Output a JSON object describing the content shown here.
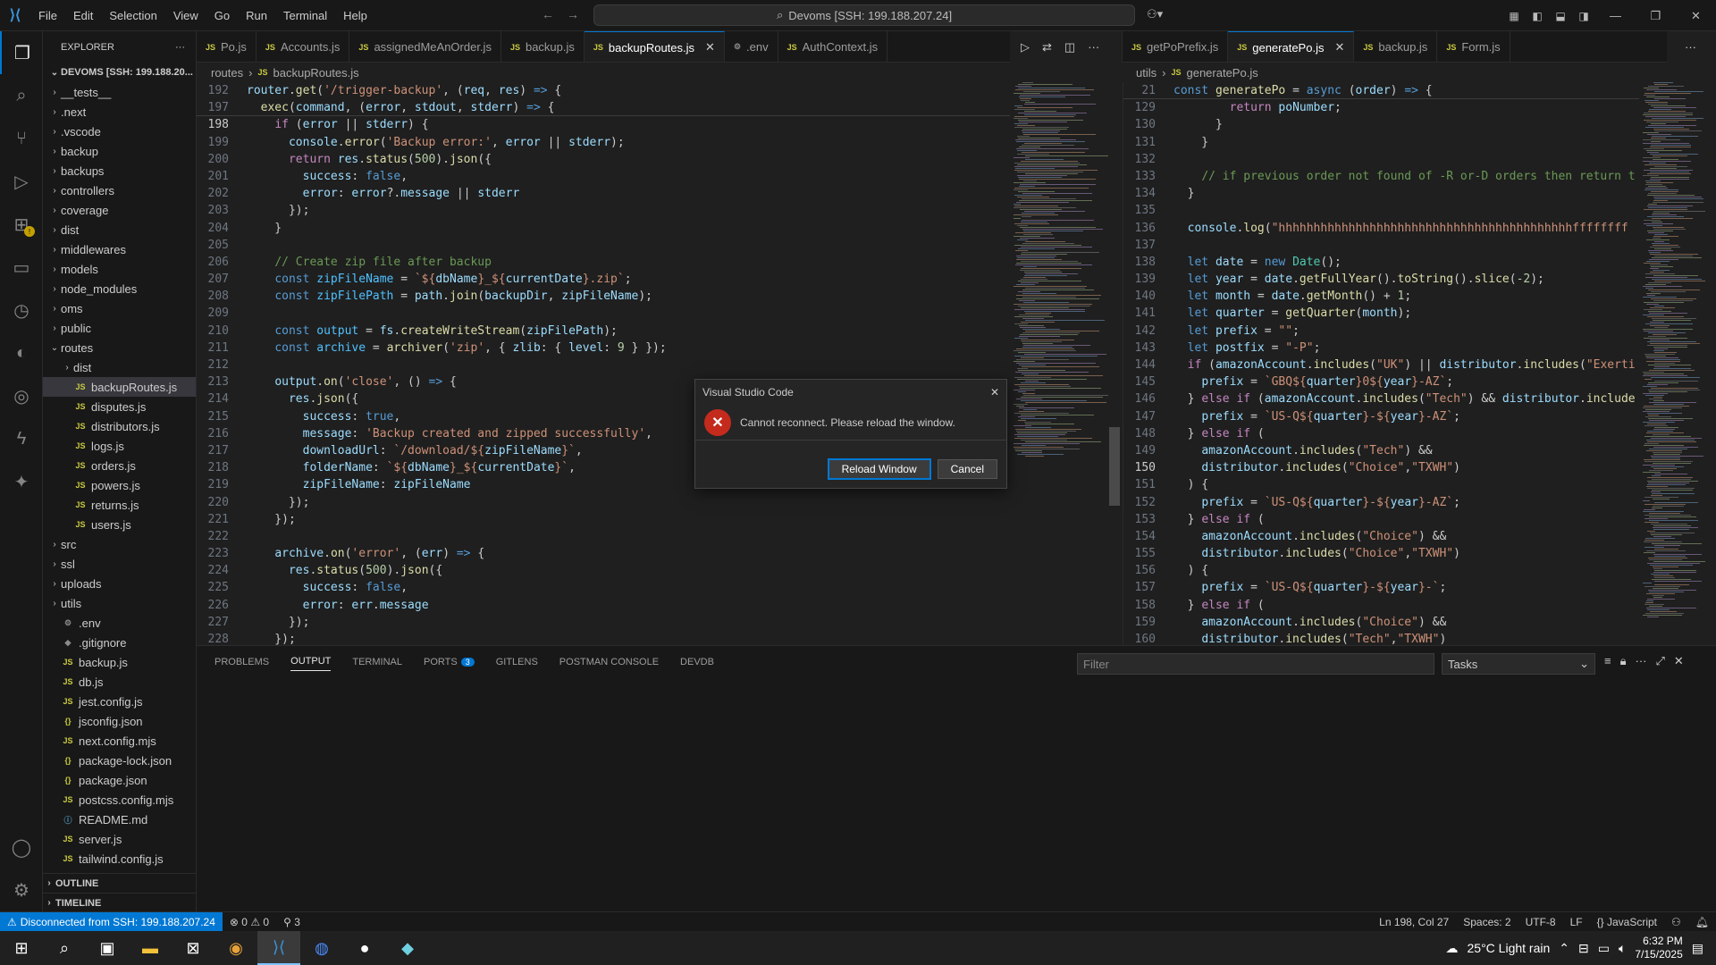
{
  "titlebar": {
    "menus": [
      "File",
      "Edit",
      "Selection",
      "View",
      "Go",
      "Run",
      "Terminal",
      "Help"
    ],
    "command_center": "Devoms [SSH: 199.188.207.24]"
  },
  "explorer": {
    "title": "EXPLORER",
    "root": "DEVOMS [SSH: 199.188.20...",
    "items": [
      {
        "label": "__tests__",
        "type": "folder",
        "depth": 0
      },
      {
        "label": ".next",
        "type": "folder",
        "depth": 0
      },
      {
        "label": ".vscode",
        "type": "folder",
        "depth": 0
      },
      {
        "label": "backup",
        "type": "folder",
        "depth": 0
      },
      {
        "label": "backups",
        "type": "folder",
        "depth": 0
      },
      {
        "label": "controllers",
        "type": "folder",
        "depth": 0
      },
      {
        "label": "coverage",
        "type": "folder",
        "depth": 0
      },
      {
        "label": "dist",
        "type": "folder",
        "depth": 0
      },
      {
        "label": "middlewares",
        "type": "folder",
        "depth": 0
      },
      {
        "label": "models",
        "type": "folder",
        "depth": 0
      },
      {
        "label": "node_modules",
        "type": "folder",
        "depth": 0
      },
      {
        "label": "oms",
        "type": "folder",
        "depth": 0
      },
      {
        "label": "public",
        "type": "folder",
        "depth": 0
      },
      {
        "label": "routes",
        "type": "folder-open",
        "depth": 0
      },
      {
        "label": "dist",
        "type": "folder",
        "depth": 1
      },
      {
        "label": "backupRoutes.js",
        "type": "js",
        "depth": 1,
        "selected": true
      },
      {
        "label": "disputes.js",
        "type": "js",
        "depth": 1
      },
      {
        "label": "distributors.js",
        "type": "js",
        "depth": 1
      },
      {
        "label": "logs.js",
        "type": "js",
        "depth": 1
      },
      {
        "label": "orders.js",
        "type": "js",
        "depth": 1
      },
      {
        "label": "powers.js",
        "type": "js",
        "depth": 1
      },
      {
        "label": "returns.js",
        "type": "js",
        "depth": 1
      },
      {
        "label": "users.js",
        "type": "js",
        "depth": 1
      },
      {
        "label": "src",
        "type": "folder",
        "depth": 0
      },
      {
        "label": "ssl",
        "type": "folder",
        "depth": 0
      },
      {
        "label": "uploads",
        "type": "folder",
        "depth": 0
      },
      {
        "label": "utils",
        "type": "folder",
        "depth": 0
      },
      {
        "label": ".env",
        "type": "gear",
        "depth": 0
      },
      {
        "label": ".gitignore",
        "type": "git",
        "depth": 0
      },
      {
        "label": "backup.js",
        "type": "js",
        "depth": 0
      },
      {
        "label": "db.js",
        "type": "js",
        "depth": 0
      },
      {
        "label": "jest.config.js",
        "type": "js",
        "depth": 0
      },
      {
        "label": "jsconfig.json",
        "type": "json",
        "depth": 0
      },
      {
        "label": "next.config.mjs",
        "type": "js",
        "depth": 0
      },
      {
        "label": "package-lock.json",
        "type": "json",
        "depth": 0
      },
      {
        "label": "package.json",
        "type": "json",
        "depth": 0
      },
      {
        "label": "postcss.config.mjs",
        "type": "js",
        "depth": 0
      },
      {
        "label": "README.md",
        "type": "info",
        "depth": 0
      },
      {
        "label": "server.js",
        "type": "js",
        "depth": 0
      },
      {
        "label": "tailwind.config.js",
        "type": "js",
        "depth": 0
      }
    ],
    "outline": "OUTLINE",
    "timeline": "TIMELINE"
  },
  "left_tabs": [
    {
      "label": "Po.js",
      "active": false
    },
    {
      "label": "Accounts.js",
      "active": false
    },
    {
      "label": "assignedMeAnOrder.js",
      "active": false
    },
    {
      "label": "backup.js",
      "active": false
    },
    {
      "label": "backupRoutes.js",
      "active": true
    },
    {
      "label": ".env",
      "active": false,
      "gear": true
    },
    {
      "label": "AuthContext.js",
      "active": false
    }
  ],
  "right_tabs": [
    {
      "label": "getPoPrefix.js",
      "active": false
    },
    {
      "label": "generatePo.js",
      "active": true
    },
    {
      "label": "backup.js",
      "active": false
    },
    {
      "label": "Form.js",
      "active": false
    }
  ],
  "left_breadcrumb": {
    "folder": "routes",
    "file": "backupRoutes.js"
  },
  "right_breadcrumb": {
    "folder": "utils",
    "file": "generatePo.js"
  },
  "left_editor": {
    "current_line": 198,
    "lines": [
      {
        "n": 192,
        "html": "<span class='var'>router</span>.<span class='fn'>get</span>(<span class='str'>'/trigger-backup'</span>, (<span class='var'>req</span>, <span class='var'>res</span>) <span class='kw'>=&gt;</span> {"
      },
      {
        "n": 197,
        "html": "  <span class='fn'>exec</span>(<span class='var'>command</span>, (<span class='var'>error</span>, <span class='var'>stdout</span>, <span class='var'>stderr</span>) <span class='kw'>=&gt;</span> {"
      },
      {
        "n": 198,
        "html": "    <span class='ctl'>if</span> (<span class='var'>error</span> || <span class='var'>stderr</span>) {"
      },
      {
        "n": 199,
        "html": "      <span class='var'>console</span>.<span class='fn'>error</span>(<span class='str'>'Backup error:'</span>, <span class='var'>error</span> || <span class='var'>stderr</span>);"
      },
      {
        "n": 200,
        "html": "      <span class='ctl'>return</span> <span class='var'>res</span>.<span class='fn'>status</span>(<span class='num'>500</span>).<span class='fn'>json</span>({"
      },
      {
        "n": 201,
        "html": "        <span class='var'>success</span>: <span class='kw'>false</span>,"
      },
      {
        "n": 202,
        "html": "        <span class='var'>error</span>: <span class='var'>error</span>?.<span class='var'>message</span> || <span class='var'>stderr</span>"
      },
      {
        "n": 203,
        "html": "      });"
      },
      {
        "n": 204,
        "html": "    }"
      },
      {
        "n": 205,
        "html": ""
      },
      {
        "n": 206,
        "html": "    <span class='cm'>// Create zip file after backup</span>"
      },
      {
        "n": 207,
        "html": "    <span class='kw'>const</span> <span class='cst'>zipFileName</span> = <span class='str'>`${</span><span class='var'>dbName</span><span class='str'>}_${</span><span class='var'>currentDate</span><span class='str'>}.zip`</span>;"
      },
      {
        "n": 208,
        "html": "    <span class='kw'>const</span> <span class='cst'>zipFilePath</span> = <span class='var'>path</span>.<span class='fn'>join</span>(<span class='var'>backupDir</span>, <span class='var'>zipFileName</span>);"
      },
      {
        "n": 209,
        "html": ""
      },
      {
        "n": 210,
        "html": "    <span class='kw'>const</span> <span class='cst'>output</span> = <span class='var'>fs</span>.<span class='fn'>createWriteStream</span>(<span class='var'>zipFilePath</span>);"
      },
      {
        "n": 211,
        "html": "    <span class='kw'>const</span> <span class='cst'>archive</span> = <span class='fn'>archiver</span>(<span class='str'>'zip'</span>, { <span class='var'>zlib</span>: { <span class='var'>level</span>: <span class='num'>9</span> } });"
      },
      {
        "n": 212,
        "html": ""
      },
      {
        "n": 213,
        "html": "    <span class='var'>output</span>.<span class='fn'>on</span>(<span class='str'>'close'</span>, () <span class='kw'>=&gt;</span> {"
      },
      {
        "n": 214,
        "html": "      <span class='var'>res</span>.<span class='fn'>json</span>({"
      },
      {
        "n": 215,
        "html": "        <span class='var'>success</span>: <span class='kw'>true</span>,"
      },
      {
        "n": 216,
        "html": "        <span class='var'>message</span>: <span class='str'>'Backup created and zipped successfully'</span>,"
      },
      {
        "n": 217,
        "html": "        <span class='var'>downloadUrl</span>: <span class='str'>`/download/${</span><span class='var'>zipFileName</span><span class='str'>}`</span>,"
      },
      {
        "n": 218,
        "html": "        <span class='var'>folderName</span>: <span class='str'>`${</span><span class='var'>dbName</span><span class='str'>}_${</span><span class='var'>currentDate</span><span class='str'>}`</span>,"
      },
      {
        "n": 219,
        "html": "        <span class='var'>zipFileName</span>: <span class='var'>zipFileName</span>"
      },
      {
        "n": 220,
        "html": "      });"
      },
      {
        "n": 221,
        "html": "    });"
      },
      {
        "n": 222,
        "html": ""
      },
      {
        "n": 223,
        "html": "    <span class='var'>archive</span>.<span class='fn'>on</span>(<span class='str'>'error'</span>, (<span class='var'>err</span>) <span class='kw'>=&gt;</span> {"
      },
      {
        "n": 224,
        "html": "      <span class='var'>res</span>.<span class='fn'>status</span>(<span class='num'>500</span>).<span class='fn'>json</span>({"
      },
      {
        "n": 225,
        "html": "        <span class='var'>success</span>: <span class='kw'>false</span>,"
      },
      {
        "n": 226,
        "html": "        <span class='var'>error</span>: <span class='var'>err</span>.<span class='var'>message</span>"
      },
      {
        "n": 227,
        "html": "      });"
      },
      {
        "n": 228,
        "html": "    });"
      }
    ]
  },
  "right_editor": {
    "current_line": 150,
    "lines": [
      {
        "n": 21,
        "html": "<span class='kw'>const</span> <span class='fn'>generatePo</span> = <span class='kw'>async</span> (<span class='var'>order</span>) <span class='kw'>=&gt;</span> {"
      },
      {
        "n": 129,
        "html": "        <span class='ctl'>return</span> <span class='var'>poNumber</span>;"
      },
      {
        "n": 130,
        "html": "      }"
      },
      {
        "n": 131,
        "html": "    }"
      },
      {
        "n": 132,
        "html": ""
      },
      {
        "n": 133,
        "html": "    <span class='cm'>// if previous order not found of -R or-D orders then return t</span>"
      },
      {
        "n": 134,
        "html": "  }"
      },
      {
        "n": 135,
        "html": ""
      },
      {
        "n": 136,
        "html": "  <span class='var'>console</span>.<span class='fn'>log</span>(<span class='str'>\"hhhhhhhhhhhhhhhhhhhhhhhhhhhhhhhhhhhhhhhhhhffffffff</span>"
      },
      {
        "n": 137,
        "html": ""
      },
      {
        "n": 138,
        "html": "  <span class='kw'>let</span> <span class='var'>date</span> = <span class='kw'>new</span> <span class='cls'>Date</span>();"
      },
      {
        "n": 139,
        "html": "  <span class='kw'>let</span> <span class='var'>year</span> = <span class='var'>date</span>.<span class='fn'>getFullYear</span>().<span class='fn'>toString</span>().<span class='fn'>slice</span>(<span class='num'>-2</span>);"
      },
      {
        "n": 140,
        "html": "  <span class='kw'>let</span> <span class='var'>month</span> = <span class='var'>date</span>.<span class='fn'>getMonth</span>() + <span class='num'>1</span>;"
      },
      {
        "n": 141,
        "html": "  <span class='kw'>let</span> <span class='var'>quarter</span> = <span class='fn'>getQuarter</span>(<span class='var'>month</span>);"
      },
      {
        "n": 142,
        "html": "  <span class='kw'>let</span> <span class='var'>prefix</span> = <span class='str'>\"\"</span>;"
      },
      {
        "n": 143,
        "html": "  <span class='kw'>let</span> <span class='var'>postfix</span> = <span class='str'>\"-P\"</span>;"
      },
      {
        "n": 144,
        "html": "  <span class='ctl'>if</span> (<span class='var'>amazonAccount</span>.<span class='fn'>includes</span>(<span class='str'>\"UK\"</span>) || <span class='var'>distributor</span>.<span class='fn'>includes</span>(<span class='str'>\"Exerti</span>"
      },
      {
        "n": 145,
        "html": "    <span class='var'>prefix</span> = <span class='str'>`GBQ${</span><span class='var'>quarter</span><span class='str'>}0${</span><span class='var'>year</span><span class='str'>}-AZ`</span>;"
      },
      {
        "n": 146,
        "html": "  } <span class='ctl'>else if</span> (<span class='var'>amazonAccount</span>.<span class='fn'>includes</span>(<span class='str'>\"Tech\"</span>) &amp;&amp; <span class='var'>distributor</span>.<span class='fn'>include</span>"
      },
      {
        "n": 147,
        "html": "    <span class='var'>prefix</span> = <span class='str'>`US-Q${</span><span class='var'>quarter</span><span class='str'>}-${</span><span class='var'>year</span><span class='str'>}-AZ`</span>;"
      },
      {
        "n": 148,
        "html": "  } <span class='ctl'>else if</span> ("
      },
      {
        "n": 149,
        "html": "    <span class='var'>amazonAccount</span>.<span class='fn'>includes</span>(<span class='str'>\"Tech\"</span>) &amp;&amp;"
      },
      {
        "n": 150,
        "html": "    <span class='var'>distributor</span>.<span class='fn'>includes</span>(<span class='str'>\"Choice\"</span>,<span class='str'>\"TXWH\"</span>)"
      },
      {
        "n": 151,
        "html": "  ) {"
      },
      {
        "n": 152,
        "html": "    <span class='var'>prefix</span> = <span class='str'>`US-Q${</span><span class='var'>quarter</span><span class='str'>}-${</span><span class='var'>year</span><span class='str'>}-AZ`</span>;"
      },
      {
        "n": 153,
        "html": "  } <span class='ctl'>else if</span> ("
      },
      {
        "n": 154,
        "html": "    <span class='var'>amazonAccount</span>.<span class='fn'>includes</span>(<span class='str'>\"Choice\"</span>) &amp;&amp;"
      },
      {
        "n": 155,
        "html": "    <span class='var'>distributor</span>.<span class='fn'>includes</span>(<span class='str'>\"Choice\"</span>,<span class='str'>\"TXWH\"</span>)"
      },
      {
        "n": 156,
        "html": "  ) {"
      },
      {
        "n": 157,
        "html": "    <span class='var'>prefix</span> = <span class='str'>`US-Q${</span><span class='var'>quarter</span><span class='str'>}-${</span><span class='var'>year</span><span class='str'>}-`</span>;"
      },
      {
        "n": 158,
        "html": "  } <span class='ctl'>else if</span> ("
      },
      {
        "n": 159,
        "html": "    <span class='var'>amazonAccount</span>.<span class='fn'>includes</span>(<span class='str'>\"Choice\"</span>) &amp;&amp;"
      },
      {
        "n": 160,
        "html": "    <span class='var'>distributor</span>.<span class='fn'>includes</span>(<span class='str'>\"Tech\"</span>,<span class='str'>\"TXWH\"</span>)"
      }
    ]
  },
  "panel": {
    "tabs": [
      {
        "label": "PROBLEMS",
        "active": false
      },
      {
        "label": "OUTPUT",
        "active": true
      },
      {
        "label": "TERMINAL",
        "active": false
      },
      {
        "label": "PORTS",
        "active": false,
        "badge": "3"
      },
      {
        "label": "GITLENS",
        "active": false
      },
      {
        "label": "POSTMAN CONSOLE",
        "active": false
      },
      {
        "label": "DEVDB",
        "active": false
      }
    ],
    "filter_placeholder": "Filter",
    "task_select": "Tasks"
  },
  "dialog": {
    "title": "Visual Studio Code",
    "message": "Cannot reconnect. Please reload the window.",
    "primary": "Reload Window",
    "cancel": "Cancel"
  },
  "statusbar": {
    "remote": "Disconnected from SSH: 199.188.207.24",
    "errors": "0",
    "warnings": "0",
    "ports": "3",
    "position": "Ln 198, Col 27",
    "spaces": "Spaces: 2",
    "encoding": "UTF-8",
    "eol": "LF",
    "language": "JavaScript"
  },
  "taskbar": {
    "weather": "25°C  Light rain",
    "time": "6:32 PM",
    "date": "7/15/2025"
  },
  "colors": {
    "accent": "#0078d4",
    "error": "#c42b1c",
    "background": "#1f1f1f"
  }
}
